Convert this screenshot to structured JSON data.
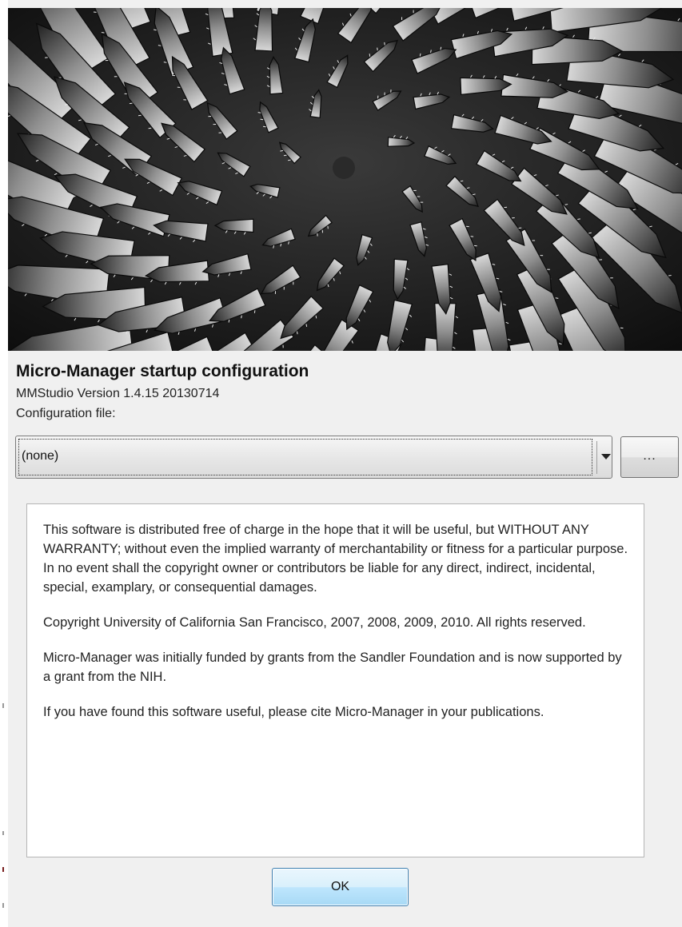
{
  "dialog": {
    "title": "Micro-Manager startup configuration",
    "version": "MMStudio Version 1.4.15  20130714",
    "config_label": "Configuration file:"
  },
  "config_select": {
    "selected": "(none)",
    "browse_label": "..."
  },
  "license": {
    "paragraphs": [
      "This software is distributed free of charge in the hope that it will be useful, but WITHOUT ANY WARRANTY; without even the implied warranty of merchantability or fitness for a particular purpose. In no event shall the copyright owner or contributors be liable for any direct, indirect, incidental, special, examplary, or consequential damages.",
      "Copyright University of California San Francisco, 2007, 2008, 2009, 2010. All rights reserved.",
      "Micro-Manager was initially funded by grants from the Sandler Foundation and is now supported by a grant from the NIH.",
      "If you have found this software useful, please cite Micro-Manager in your publications."
    ]
  },
  "buttons": {
    "ok": "OK"
  },
  "icons": {
    "splash": "aloe-spiral-photo",
    "dropdown": "chevron-down-icon"
  },
  "colors": {
    "ok_border": "#3c7fb1",
    "ok_fill": "#bee6fd",
    "panel_bg": "#f0f0f0"
  }
}
